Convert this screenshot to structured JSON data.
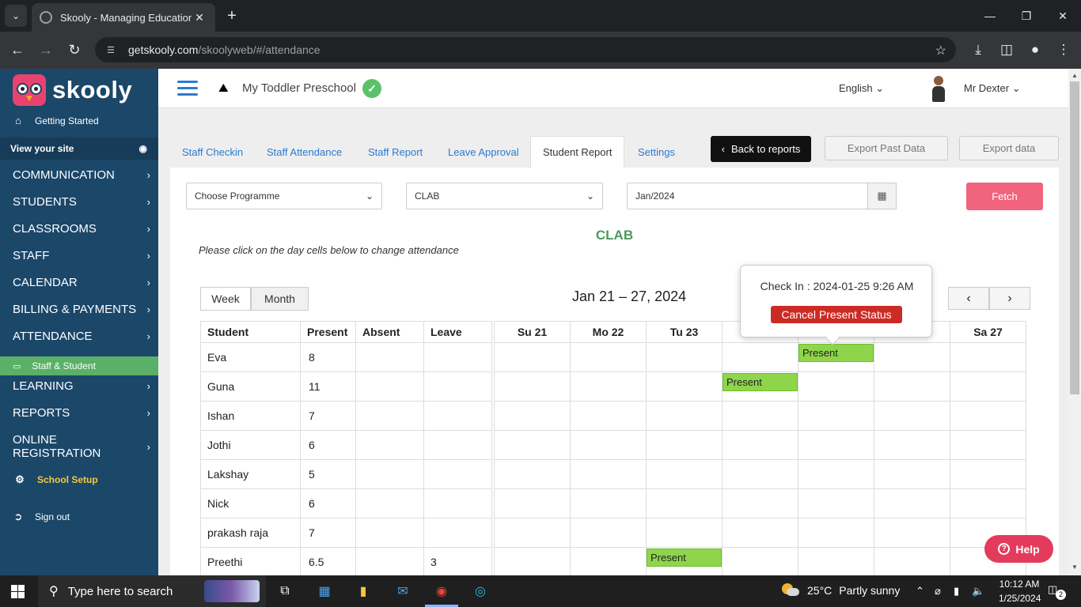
{
  "browser": {
    "tab_title": "Skooly - Managing Educational",
    "url_host": "getskooly.com",
    "url_path": "/skoolyweb/#/attendance"
  },
  "sidebar": {
    "brand": "skooly",
    "getting_started": "Getting Started",
    "view_site": "View your site",
    "items": [
      {
        "label": "COMMUNICATION"
      },
      {
        "label": "STUDENTS"
      },
      {
        "label": "CLASSROOMS"
      },
      {
        "label": "STAFF"
      },
      {
        "label": "CALENDAR"
      },
      {
        "label": "BILLING & PAYMENTS"
      },
      {
        "label": "ATTENDANCE"
      },
      {
        "label": "LEARNING"
      },
      {
        "label": "REPORTS"
      },
      {
        "label": "ONLINE REGISTRATION"
      }
    ],
    "active_subitem": "Staff & Student",
    "school_setup": "School Setup",
    "sign_out": "Sign out"
  },
  "header": {
    "school_name": "My Toddler Preschool",
    "language": "English",
    "user": "Mr Dexter"
  },
  "tabs": [
    {
      "label": "Staff Checkin"
    },
    {
      "label": "Staff Attendance"
    },
    {
      "label": "Staff Report"
    },
    {
      "label": "Leave Approval"
    },
    {
      "label": "Student Report"
    },
    {
      "label": "Settings"
    }
  ],
  "actions": {
    "back": "Back to reports",
    "export_past": "Export Past Data",
    "export": "Export data",
    "fetch": "Fetch"
  },
  "filters": {
    "programme": "Choose Programme",
    "group": "CLAB",
    "month": "Jan/2024"
  },
  "report": {
    "group_title": "CLAB",
    "hint": "Please click on the day cells below to change attendance",
    "view_week": "Week",
    "view_month": "Month",
    "range": "Jan 21 – 27, 2024"
  },
  "table": {
    "headers": [
      "Student",
      "Present",
      "Absent",
      "Leave"
    ],
    "rows": [
      {
        "name": "Eva",
        "present": "8",
        "absent": "",
        "leave": ""
      },
      {
        "name": "Guna",
        "present": "11",
        "absent": "",
        "leave": ""
      },
      {
        "name": "Ishan",
        "present": "7",
        "absent": "",
        "leave": ""
      },
      {
        "name": "Jothi",
        "present": "6",
        "absent": "",
        "leave": ""
      },
      {
        "name": "Lakshay",
        "present": "5",
        "absent": "",
        "leave": ""
      },
      {
        "name": "Nick",
        "present": "6",
        "absent": "",
        "leave": ""
      },
      {
        "name": "prakash raja",
        "present": "7",
        "absent": "",
        "leave": ""
      },
      {
        "name": "Preethi",
        "present": "6.5",
        "absent": "",
        "leave": "3"
      }
    ]
  },
  "calendar": {
    "days": [
      "Su 21",
      "Mo 22",
      "Tu 23",
      "",
      "",
      "",
      "Sa 27"
    ],
    "present_label": "Present"
  },
  "popover": {
    "checkin": "Check In : 2024-01-25 9:26 AM",
    "cancel": "Cancel Present Status"
  },
  "help": "Help",
  "taskbar": {
    "search": "Type here to search",
    "temp": "25°C",
    "weather": "Partly sunny",
    "time": "10:12 AM",
    "date": "1/25/2024",
    "notifications": "2"
  },
  "colors": {
    "sidebar_bg": "#1b4769",
    "accent_green": "#5ab067",
    "fetch_pink": "#f2647e",
    "present_green": "#8fd54c",
    "cancel_red": "#cc2b24",
    "help_red": "#e33b5c"
  }
}
